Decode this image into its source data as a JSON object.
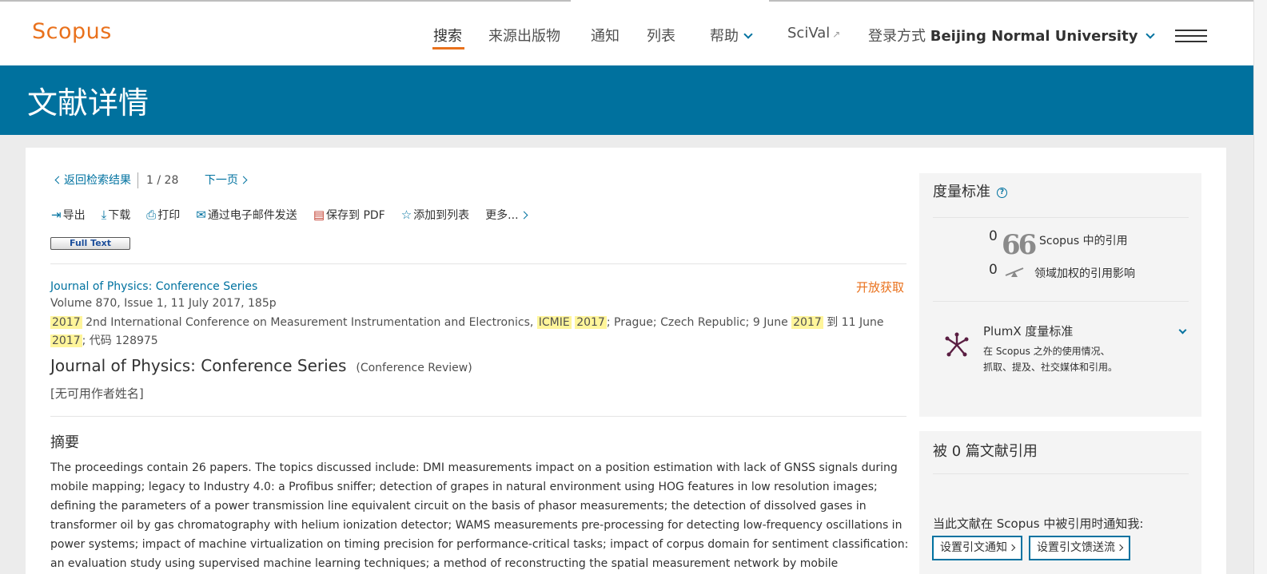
{
  "header": {
    "logo": "Scopus",
    "nav": [
      "搜索",
      "来源出版物",
      "通知",
      "列表"
    ],
    "help": "帮助",
    "scival": "SciVal",
    "login_prefix": "登录方式",
    "institution": "Beijing Normal University"
  },
  "banner": {
    "title": "文献详情"
  },
  "doc_nav": {
    "back": "返回检索结果",
    "current": "1",
    "sep": "/",
    "total": "28",
    "next": "下一页"
  },
  "actions": {
    "export": "导出",
    "download": "下载",
    "print": "打印",
    "email": "通过电子邮件发送",
    "pdf": "保存到 PDF",
    "add_list": "添加到列表",
    "more": "更多..."
  },
  "full_text": "Full Text",
  "document": {
    "journal": "Journal of Physics: Conference Series",
    "open_access": "开放获取",
    "volume": "Volume 870, Issue 1, 11 July 2017, 185p",
    "conf": {
      "y1": "2017",
      "t1": " 2nd International Conference on Measurement Instrumentation and Electronics, ",
      "acr": "ICMIE",
      "y2": "2017",
      "t2": "; Prague; Czech Republic; 9 June ",
      "y3": "2017",
      "t3": " 到 11 June ",
      "y4": "2017",
      "t4": "; 代码 128975"
    },
    "title": "Journal of Physics: Conference Series",
    "type": "(Conference Review)",
    "authors": "[无可用作者姓名]"
  },
  "abstract": {
    "heading": "摘要",
    "text": "The proceedings contain 26 papers. The topics discussed include: DMI measurements impact on a position estimation with lack of GNSS signals during mobile mapping; legacy to Industry 4.0: a Profibus sniffer; detection of grapes in natural environment using HOG features in low resolution images; defining the parameters of a power transmission line equivalent circuit on the basis of phasor measurements; the detection of dissolved gases in transformer oil by gas chromatography with helium ionization detector; WAMS measurements pre-processing for detecting low-frequency oscillations in power systems; impact of machine virtualization on timing precision for performance-critical tasks; impact of corpus domain for sentiment classification: an evaluation study using supervised machine learning techniques; a method of reconstructing the spatial measurement network by mobile measurement transmitter for shipbuilding; experimental"
  },
  "metrics": {
    "title": "度量标准",
    "help": "?",
    "citations": "0",
    "citations_label": "Scopus 中的引用",
    "fwci": "0",
    "fwci_label": "领域加权的引用影响",
    "plumx_title": "PlumX 度量标准",
    "plumx_desc": "在 Scopus 之外的使用情况、抓取、提及、社交媒体和引用。"
  },
  "cited_by": {
    "title": "被 0 篇文献引用",
    "notify_text": "当此文献在 Scopus 中被引用时通知我:",
    "btn_alert": "设置引文通知",
    "btn_feed": "设置引文馈送流"
  },
  "colors": {
    "brand_orange": "#e9711c",
    "banner_blue": "#00719e",
    "link_blue": "#0072a0"
  }
}
